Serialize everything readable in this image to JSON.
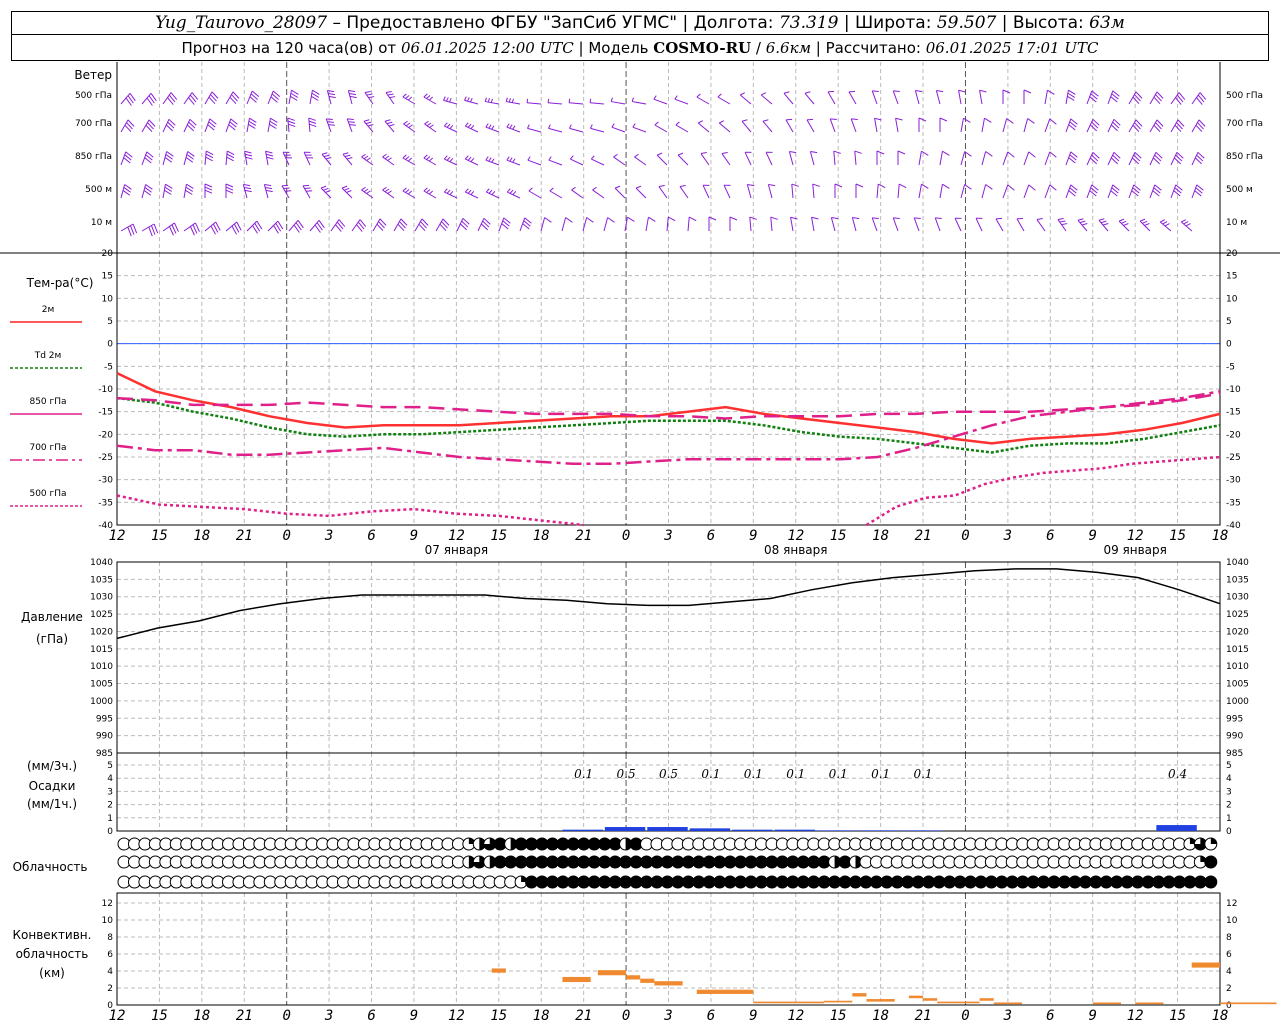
{
  "header": {
    "station": "Yug_Taurovo_28097",
    "provider": "Предоставлено ФГБУ \"ЗапСиб УГМС\"",
    "lon_label": "Долгота:",
    "lon": "73.319",
    "lat_label": "Широта:",
    "lat": "59.507",
    "alt_label": "Высота:",
    "alt": "63м",
    "forecast_label": "Прогноз на 120 часа(ов) от",
    "forecast_start": "06.01.2025 12:00 UTC",
    "model_label": "Модель",
    "model": "COSMO-RU",
    "model_res": "6.6км",
    "calc_label": "Рассчитано:",
    "calc_time": "06.01.2025 17:01 UTC",
    "sep": "|"
  },
  "wind_panel": {
    "title": "Ветер",
    "levels": [
      "500 гПа",
      "700 гПа",
      "850 гПа",
      "500 м",
      "10 м"
    ]
  },
  "temp_panel": {
    "title": "Тем-ра(°С)",
    "legend": [
      {
        "label": "2м",
        "color": "#ff2020",
        "dash": ""
      },
      {
        "label": "Td  2м",
        "color": "#108010",
        "dash": "3,2"
      },
      {
        "label": "850 гПа",
        "color": "#e0208a",
        "dash": ""
      },
      {
        "label": "700 гПа",
        "color": "#e0208a",
        "dash": "12,4,3,4"
      },
      {
        "label": "500 гПа",
        "color": "#e0208a",
        "dash": "3,2"
      }
    ]
  },
  "pressure_panel": {
    "title": "Давление",
    "unit": "(гПа)"
  },
  "precip_panel": {
    "title1": "(мм/3ч.)",
    "title2": "Осадки",
    "title3": "(мм/1ч.)"
  },
  "cloud_panel": {
    "title": "Облачность"
  },
  "conv_panel": {
    "title1": "Конвективн.",
    "title2": "облачность",
    "title3": "(км)"
  },
  "days": [
    "07 января",
    "08 января",
    "09 января"
  ],
  "x_ticks": [
    "12",
    "15",
    "18",
    "21",
    "0",
    "3",
    "6",
    "9",
    "12",
    "15",
    "18",
    "21",
    "0",
    "3",
    "6",
    "9",
    "12",
    "15",
    "18",
    "21",
    "0",
    "3",
    "6",
    "9",
    "12",
    "15",
    "18"
  ],
  "colors": {
    "wind": "#8a1fd6",
    "temp2m": "#ff3030",
    "td2m": "#108010",
    "pink": "#e0208a",
    "precip": "#2040e0",
    "conv": "#f08a30",
    "zero": "#3060ff"
  },
  "chart_data": [
    {
      "type": "line",
      "title": "Тем-ра(°С)",
      "x_hours": [
        0,
        3,
        6,
        9,
        12,
        15,
        18,
        21,
        24,
        27,
        30,
        33,
        36,
        39,
        42,
        45,
        48,
        51,
        54,
        57,
        60,
        63,
        66,
        69,
        72,
        75,
        78
      ],
      "ylim": [
        -40,
        20
      ],
      "yticks": [
        20,
        15,
        10,
        5,
        0,
        -5,
        -10,
        -15,
        -20,
        -25,
        -30,
        -35,
        -40
      ],
      "series": [
        {
          "name": "2м",
          "values": [
            -6.5,
            -10.5,
            -12.5,
            -14,
            -16,
            -17.5,
            -18.5,
            -18,
            -18,
            -18,
            -17.5,
            -17,
            -16.5,
            -16,
            -16,
            -15,
            -14,
            -15.5,
            -16.5,
            -17.5,
            -18.5,
            -19.5,
            -21,
            -22,
            -21,
            -20.5,
            -20,
            -19,
            -17.5,
            -15.5
          ]
        },
        {
          "name": "Td  2м",
          "values": [
            -12,
            -13,
            -15,
            -16.5,
            -18.5,
            -20,
            -20.5,
            -20,
            -20,
            -19.5,
            -19,
            -18.5,
            -18,
            -17.5,
            -17,
            -17,
            -17,
            -18,
            -19.5,
            -20.5,
            -21,
            -22,
            -23,
            -24,
            -22.5,
            -22,
            -22,
            -21,
            -19.5,
            -18
          ]
        },
        {
          "name": "850 гПа",
          "values": [
            -12,
            -12.5,
            -13.5,
            -13.5,
            -13.5,
            -13,
            -13.5,
            -14,
            -14,
            -14.5,
            -15,
            -15.5,
            -15.5,
            -15.5,
            -16,
            -16,
            -16.5,
            -16,
            -16,
            -16,
            -15.5,
            -15.5,
            -15,
            -15,
            -15,
            -14.5,
            -14,
            -13.5,
            -12.5,
            -11
          ]
        },
        {
          "name": "700 гПа",
          "values": [
            -22.5,
            -23.5,
            -23.5,
            -24.5,
            -24.5,
            -24,
            -23.5,
            -23,
            -24,
            -25,
            -25.5,
            -26,
            -26.5,
            -26.5,
            -26,
            -25.5,
            -25.5,
            -25.5,
            -25.5,
            -25.5,
            -25,
            -23,
            -20.5,
            -18,
            -16,
            -15,
            -14,
            -13,
            -12,
            -10.5
          ]
        },
        {
          "name": "500 гПа",
          "values": [
            -33.5,
            -35.5,
            -36,
            -36.5,
            -37.5,
            -38,
            -37,
            -36.5,
            -37.5,
            -38,
            -39,
            -40
          ]
        },
        {
          "name": "500 гПа (2)",
          "values": [
            -40,
            -36,
            -34,
            -33.5,
            -31,
            -29.5,
            -28.5,
            -28,
            -27.5,
            -26.5,
            -26,
            -25.5,
            -25
          ]
        }
      ]
    },
    {
      "type": "line",
      "title": "Давление",
      "ylabel": "(гПа)",
      "ylim": [
        985,
        1040
      ],
      "yticks": [
        1040,
        1035,
        1030,
        1025,
        1020,
        1015,
        1010,
        1005,
        1000,
        995,
        990,
        985
      ],
      "values": [
        1018,
        1021,
        1023,
        1026,
        1028,
        1029.5,
        1030.5,
        1030.5,
        1030.5,
        1030.5,
        1029.5,
        1029,
        1028,
        1027.5,
        1027.5,
        1028.5,
        1029.5,
        1032,
        1034,
        1035.5,
        1036.5,
        1037.5,
        1038,
        1038,
        1037,
        1035.5,
        1032,
        1028
      ]
    },
    {
      "type": "bar",
      "title": "Осадки",
      "ylim": [
        0,
        5
      ],
      "yticks": [
        5,
        4,
        3,
        2,
        1,
        0
      ],
      "labels": [
        "0.1",
        "0.5",
        "0.5",
        "0.1",
        "0.1",
        "0.1",
        "0.1",
        "0.1",
        "0.1",
        "0.4"
      ],
      "values": [
        0.1,
        0.3,
        0.3,
        0.2,
        0.1,
        0.1,
        0.05,
        0.05,
        0.05,
        0.45
      ]
    },
    {
      "type": "bar",
      "title": "Конвективн. облачность (км)",
      "ylim": [
        0,
        12
      ],
      "yticks": [
        12,
        10,
        8,
        6,
        4,
        2,
        0
      ],
      "segments": [
        {
          "h0": 26.5,
          "h1": 27.5,
          "bottom": 3.8,
          "top": 4.3
        },
        {
          "h0": 31.5,
          "h1": 33.5,
          "bottom": 2.7,
          "top": 3.3
        },
        {
          "h0": 34,
          "h1": 36,
          "bottom": 3.5,
          "top": 4.1
        },
        {
          "h0": 36,
          "h1": 37,
          "bottom": 3.0,
          "top": 3.5
        },
        {
          "h0": 37,
          "h1": 38,
          "bottom": 2.6,
          "top": 3.1
        },
        {
          "h0": 38,
          "h1": 40,
          "bottom": 2.3,
          "top": 2.8
        },
        {
          "h0": 41,
          "h1": 45,
          "bottom": 1.3,
          "top": 1.8
        },
        {
          "h0": 45,
          "h1": 50,
          "bottom": 0.2,
          "top": 0.4
        },
        {
          "h0": 50,
          "h1": 52,
          "bottom": 0.3,
          "top": 0.5
        },
        {
          "h0": 52,
          "h1": 53,
          "bottom": 1.0,
          "top": 1.4
        },
        {
          "h0": 53,
          "h1": 55,
          "bottom": 0.4,
          "top": 0.7
        },
        {
          "h0": 56,
          "h1": 57,
          "bottom": 0.8,
          "top": 1.1
        },
        {
          "h0": 57,
          "h1": 58,
          "bottom": 0.5,
          "top": 0.8
        },
        {
          "h0": 58,
          "h1": 61,
          "bottom": 0.2,
          "top": 0.4
        },
        {
          "h0": 61,
          "h1": 62,
          "bottom": 0.5,
          "top": 0.8
        },
        {
          "h0": 62,
          "h1": 64,
          "bottom": 0.1,
          "top": 0.3
        },
        {
          "h0": 69,
          "h1": 71,
          "bottom": 0.1,
          "top": 0.3
        },
        {
          "h0": 72,
          "h1": 74,
          "bottom": 0.1,
          "top": 0.3
        },
        {
          "h0": 76,
          "h1": 78,
          "bottom": 4.4,
          "top": 5.0
        },
        {
          "h0": 78,
          "h1": 82,
          "bottom": 0.1,
          "top": 0.3
        }
      ]
    },
    {
      "type": "table",
      "title": "Облачность",
      "rows": [
        "0000000000000000000000000000000001234244444444442400000000000000000000000000000000000000000000000000001314444444",
        "0000000000000000000000000000000002324444444444444444444444444444444424200000000000000000000000000000000144444444",
        "0000000000000000000000000000000000000014444444444444444444444444444444444444444444444444444444444444444444004444"
      ]
    }
  ]
}
